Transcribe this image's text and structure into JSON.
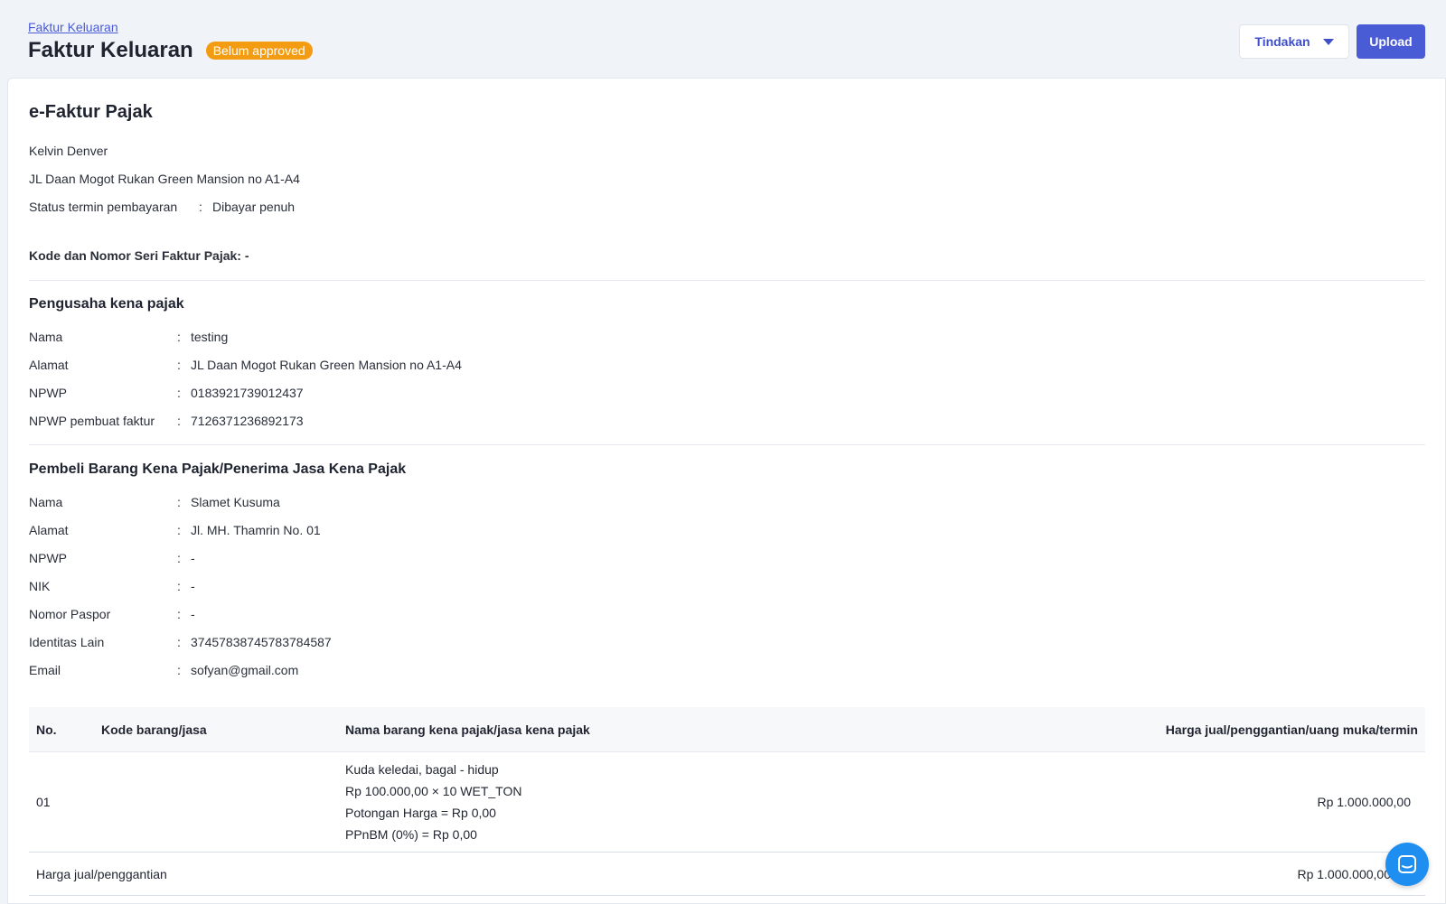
{
  "header": {
    "breadcrumb": "Faktur Keluaran",
    "title": "Faktur Keluaran",
    "badge": "Belum approved",
    "action_label": "Tindakan",
    "upload_label": "Upload"
  },
  "doc": {
    "title": "e-Faktur Pajak",
    "name": "Kelvin Denver",
    "address": "JL Daan Mogot Rukan Green Mansion no A1-A4",
    "status_label": "Status termin pembayaran",
    "status_sep": ":",
    "status_value": "Dibayar penuh",
    "kode_seri": "Kode dan Nomor Seri Faktur Pajak: -"
  },
  "pengusaha": {
    "title": "Pengusaha kena pajak",
    "rows": [
      {
        "k": "Nama",
        "v": "testing"
      },
      {
        "k": "Alamat",
        "v": "JL Daan Mogot Rukan Green Mansion no A1-A4"
      },
      {
        "k": "NPWP",
        "v": "0183921739012437"
      },
      {
        "k": "NPWP pembuat faktur",
        "v": "7126371236892173"
      }
    ]
  },
  "pembeli": {
    "title": "Pembeli Barang Kena Pajak/Penerima Jasa Kena Pajak",
    "rows": [
      {
        "k": "Nama",
        "v": "Slamet Kusuma"
      },
      {
        "k": "Alamat",
        "v": "Jl. MH. Thamrin No. 01"
      },
      {
        "k": "NPWP",
        "v": "-"
      },
      {
        "k": "NIK",
        "v": "-"
      },
      {
        "k": "Nomor Paspor",
        "v": "-"
      },
      {
        "k": "Identitas Lain",
        "v": "37457838745783784587"
      },
      {
        "k": "Email",
        "v": "sofyan@gmail.com"
      }
    ]
  },
  "table": {
    "headers": [
      "No.",
      "Kode barang/jasa",
      "Nama barang kena pajak/jasa kena pajak",
      "Harga jual/penggantian/uang muka/termin"
    ],
    "rows": [
      {
        "no": "01",
        "kode": "",
        "lines": [
          "Kuda keledai, bagal - hidup",
          "Rp 100.000,00 × 10 WET_TON",
          "Potongan Harga = Rp 0,00",
          "PPnBM (0%) = Rp 0,00"
        ],
        "harga": "Rp 1.000.000,00"
      }
    ],
    "summary_label": "Harga jual/penggantian",
    "summary_value": "Rp 1.000.000,00"
  },
  "colon": ":"
}
